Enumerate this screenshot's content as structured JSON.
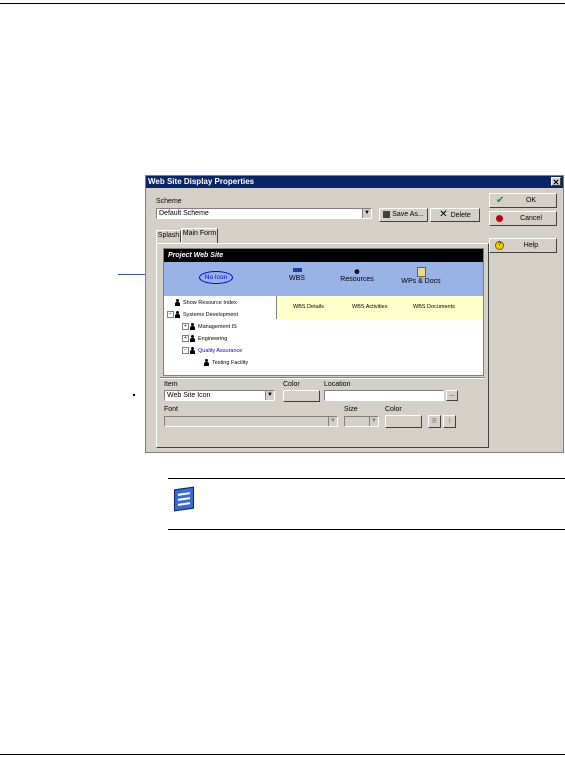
{
  "dialog": {
    "title": "Web Site Display Properties",
    "close_glyph": "✕",
    "scheme_label": "Scheme",
    "scheme_value": "Default Scheme",
    "save_as_label": "Save As...",
    "delete_label": "Delete",
    "tabs": [
      {
        "label": "Splash"
      },
      {
        "label": "Main Form"
      }
    ],
    "buttons": {
      "ok": "OK",
      "cancel": "Cancel",
      "help": "Help"
    }
  },
  "preview": {
    "title": "Project Web Site",
    "no_icon_label": "No Icon",
    "toolbar": [
      {
        "label": "WBS"
      },
      {
        "label": "Resources"
      },
      {
        "label": "WPs & Docs"
      }
    ],
    "tree": [
      {
        "label": "Show Resource Index"
      },
      {
        "label": "Systems Development"
      },
      {
        "label": "Management IS"
      },
      {
        "label": "Engineering"
      },
      {
        "label": "Quality Assurance"
      },
      {
        "label": "Testing Facility"
      }
    ],
    "wbs_tabs": [
      {
        "label": "WBS Details"
      },
      {
        "label": "WBS Activities"
      },
      {
        "label": "WBS Documents"
      }
    ]
  },
  "form": {
    "item_label": "Item",
    "item_value": "Web Site Icon",
    "color_label": "Color",
    "location_label": "Location",
    "location_value": "",
    "browse_label": "...",
    "font_label": "Font",
    "size_label": "Size",
    "font_color_label": "Color",
    "bold_label": "B",
    "italic_label": "I"
  },
  "colors": {
    "titlebar": "#0a246a",
    "dialog_bg": "#d4d0c8",
    "toolbar_bg": "#99b3e6",
    "wbs_bar_bg": "#ffffcc",
    "tree_selected": "#0000cc",
    "callout_line": "#3355aa"
  },
  "icons": [
    "note-icon",
    "person-icon",
    "checkmark-icon",
    "cancel-icon",
    "help-icon",
    "save-icon",
    "delete-icon"
  ]
}
